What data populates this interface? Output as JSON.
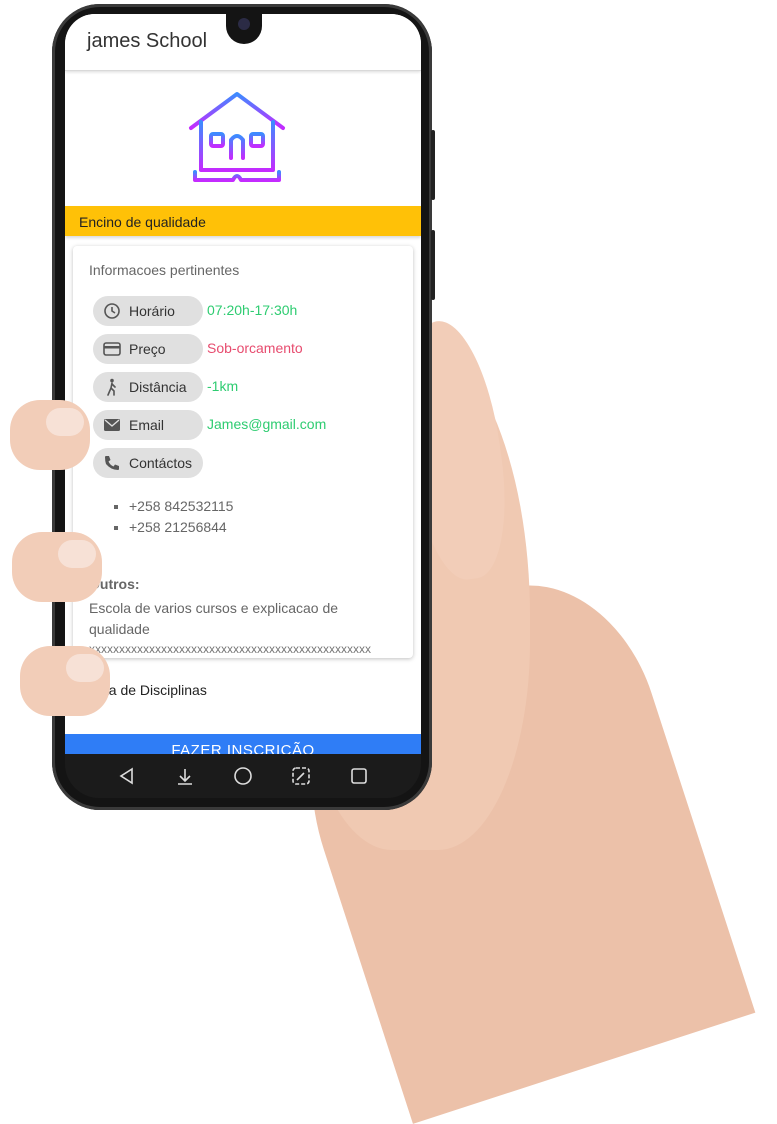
{
  "app": {
    "title": "james School"
  },
  "banner": {
    "text": "Encino de qualidade"
  },
  "card": {
    "title": "Informacoes pertinentes",
    "rows": [
      {
        "label": "Horário",
        "value": "07:20h-17:30h",
        "icon": "clock-icon",
        "color": "#2ecc71"
      },
      {
        "label": "Preço",
        "value": "Sob-orcamento",
        "icon": "credit-card-icon",
        "color": "#e74c6f"
      },
      {
        "label": "Distância",
        "value": "-1km",
        "icon": "walking-icon",
        "color": "#2ecc71"
      },
      {
        "label": "Email",
        "value": "James@gmail.com",
        "icon": "mail-icon",
        "color": "#2ecc71"
      },
      {
        "label": "Contáctos",
        "value": "",
        "icon": "phone-icon"
      }
    ],
    "phones": [
      "+258 842532115",
      "+258 21256844"
    ],
    "outros_label": "Outros:",
    "outros_text": "Escola de varios cursos e explicacao de qualidade",
    "outros_extra": "xxxxxxxxxxxxxxxxxxxxxxxxxxxxxxxxxxxxxxxxxxxxxxx"
  },
  "disciplinas_label": "Lista de Disciplinas",
  "cta_label": "FAZER INSCRIÇÃO",
  "colors": {
    "accent": "#2f7df6",
    "banner": "#ffc107"
  }
}
